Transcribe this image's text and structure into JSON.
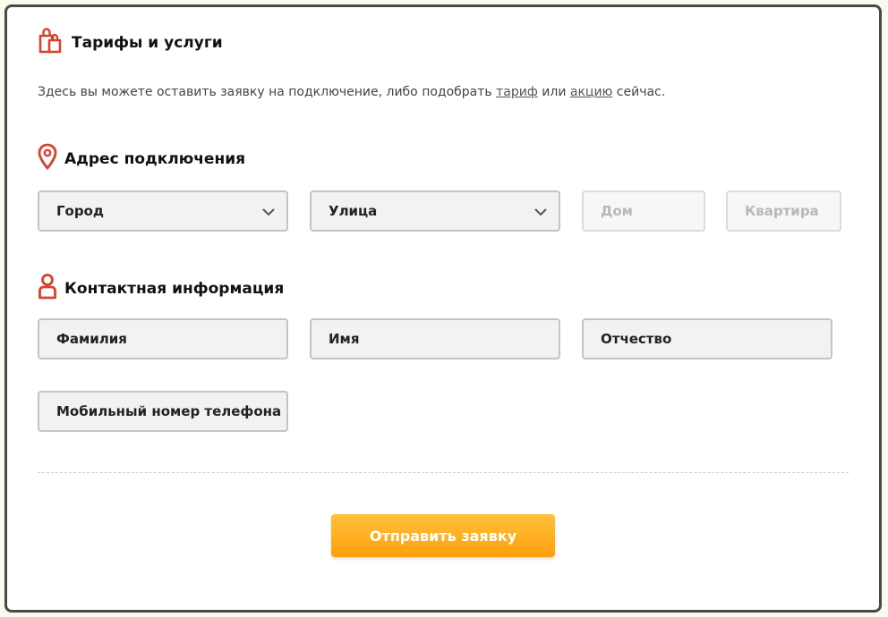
{
  "header": {
    "title": "Тарифы и услуги",
    "icon": "shopping-bags-icon"
  },
  "intro": {
    "text_before": "Здесь вы можете оставить заявку на подключение, либо подобрать ",
    "link_tariff": "тариф",
    "text_middle": " или ",
    "link_promo": "акцию",
    "text_after": " сейчас."
  },
  "address_section": {
    "title": "Адрес подключения",
    "icon": "map-pin-icon",
    "city": "Город",
    "street": "Улица",
    "house": "Дом",
    "apartment": "Квартира"
  },
  "contact_section": {
    "title": "Контактная информация",
    "icon": "person-icon",
    "last_name": "Фамилия",
    "first_name": "Имя",
    "patronymic": "Отчество",
    "phone": "Мобильный номер телефона"
  },
  "submit_label": "Отправить заявку",
  "colors": {
    "accent": "#d9402f",
    "button_top": "#ffc13a",
    "button_bottom": "#ff9f0d",
    "frame": "#4a4a44"
  }
}
